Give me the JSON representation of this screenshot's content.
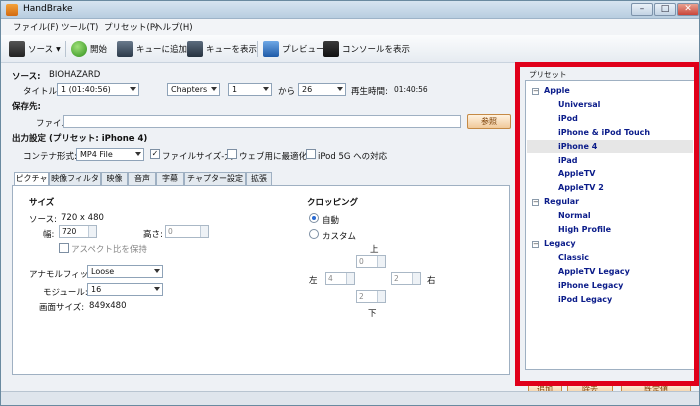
{
  "window": {
    "title": "HandBrake",
    "min": "–",
    "max": "□",
    "close": "✕"
  },
  "menu": [
    "ファイル(F)",
    "ツール(T)",
    "プリセット(P)",
    "ヘルプ(H)"
  ],
  "toolbar": {
    "source": "ソース",
    "start": "開始",
    "add_queue": "キューに追加",
    "show_queue": "キューを表示",
    "preview": "プレビュー",
    "console": "コンソールを表示"
  },
  "source": {
    "label": "ソース:",
    "value": "BIOHAZARD",
    "title_label": "タイトル:",
    "title_value": "1 (01:40:56)",
    "chapters_value": "Chapters",
    "from_value": "1",
    "to_label": "から",
    "to_value": "26",
    "duration_label": "再生時間:",
    "duration_value": "01:40:56"
  },
  "destination": {
    "heading": "保存先:",
    "file_label": "ファイル:",
    "browse": "参照"
  },
  "output": {
    "heading": "出力設定 (プリセット: iPhone 4)",
    "container_label": "コンテナ形式:",
    "container_value": "MP4 File",
    "large_file": "ファイルサイズ-大",
    "web_optimized": "ウェブ用に最適化",
    "ipod5g": "iPod 5G への対応"
  },
  "tabs": [
    "ピクチャ",
    "映像フィルター",
    "映像",
    "音声",
    "字幕",
    "チャプター設定",
    "拡張"
  ],
  "picture": {
    "size_heading": "サイズ",
    "source_label": "ソース:",
    "source_value": "720 x 480",
    "width_label": "幅:",
    "width_value": "720",
    "height_label": "高さ:",
    "height_value": "0",
    "keep_aspect": "アスペクト比を保持",
    "anamorphic_label": "アナモルフィック:",
    "anamorphic_value": "Loose",
    "modulus_label": "モジュール:",
    "modulus_value": "16",
    "display_label": "画面サイズ:",
    "display_value": "849x480",
    "crop_heading": "クロッピング",
    "auto": "自動",
    "custom": "カスタム",
    "top_label": "上",
    "bottom_label": "下",
    "left_label": "左",
    "right_label": "右",
    "crop_top": "0",
    "crop_bottom": "2",
    "crop_left": "4",
    "crop_right": "2"
  },
  "presets": {
    "heading": "プリセット",
    "groups": [
      {
        "name": "Apple",
        "items": [
          "Universal",
          "iPod",
          "iPhone & iPod Touch",
          "iPhone 4",
          "iPad",
          "AppleTV",
          "AppleTV 2"
        ]
      },
      {
        "name": "Regular",
        "items": [
          "Normal",
          "High Profile"
        ]
      },
      {
        "name": "Legacy",
        "items": [
          "Classic",
          "AppleTV Legacy",
          "iPhone Legacy",
          "iPod Legacy"
        ]
      }
    ],
    "selected": "iPhone 4",
    "add": "追加",
    "remove": "除去",
    "default": "既定値"
  },
  "colors": {
    "highlight": "#e0001a",
    "preset_text": "#0b1c8a"
  }
}
